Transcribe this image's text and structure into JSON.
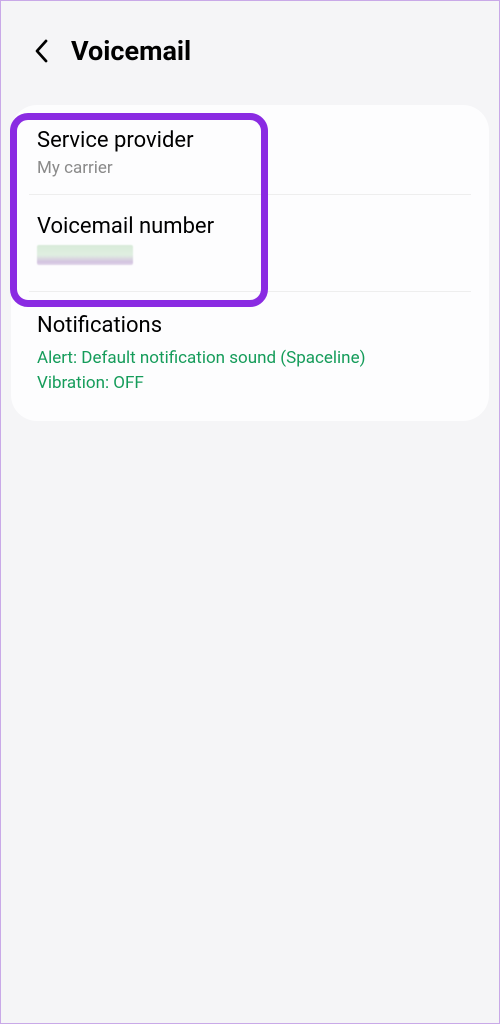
{
  "header": {
    "title": "Voicemail"
  },
  "items": [
    {
      "title": "Service provider",
      "subtitle": "My carrier"
    },
    {
      "title": "Voicemail number",
      "redacted": true
    },
    {
      "title": "Notifications",
      "line1": "Alert: Default notification sound (Spaceline)",
      "line2": "Vibration: OFF"
    }
  ],
  "colors": {
    "highlight": "#8a2be2",
    "accent": "#159c5a"
  }
}
